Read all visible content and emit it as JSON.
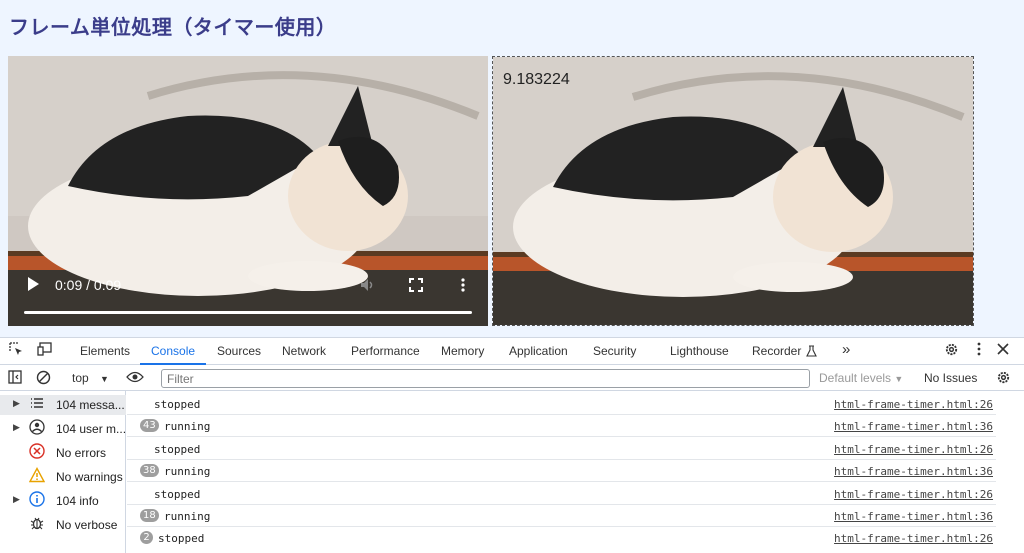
{
  "page": {
    "title": "フレーム単位処理（タイマー使用）"
  },
  "video": {
    "time_display": "0:09 / 0:09",
    "progress": 1.0
  },
  "canvas": {
    "frame_text": "9.183224"
  },
  "devtools": {
    "tabs": [
      "Elements",
      "Console",
      "Sources",
      "Network",
      "Performance",
      "Memory",
      "Application",
      "Security",
      "Lighthouse",
      "Recorder",
      "»"
    ],
    "active_tab": "Console",
    "toolbar": {
      "context": "top",
      "filter_placeholder": "Filter",
      "levels": "Default levels",
      "issues": "No Issues"
    },
    "sidebar": [
      {
        "label": "104 messa...",
        "icon": "list-icon",
        "expandable": true,
        "selected": true
      },
      {
        "label": "104 user m...",
        "icon": "user-icon",
        "expandable": true,
        "selected": false
      },
      {
        "label": "No errors",
        "icon": "error-icon",
        "expandable": false,
        "selected": false
      },
      {
        "label": "No warnings",
        "icon": "warning-icon",
        "expandable": false,
        "selected": false
      },
      {
        "label": "104 info",
        "icon": "info-icon",
        "expandable": true,
        "selected": false
      },
      {
        "label": "No verbose",
        "icon": "bug-icon",
        "expandable": false,
        "selected": false
      }
    ],
    "logs": [
      {
        "count": "",
        "message": "stopped",
        "source": "html-frame-timer.html:26"
      },
      {
        "count": "43",
        "message": "running",
        "source": "html-frame-timer.html:36"
      },
      {
        "count": "",
        "message": "stopped",
        "source": "html-frame-timer.html:26"
      },
      {
        "count": "38",
        "message": "running",
        "source": "html-frame-timer.html:36"
      },
      {
        "count": "",
        "message": "stopped",
        "source": "html-frame-timer.html:26"
      },
      {
        "count": "18",
        "message": "running",
        "source": "html-frame-timer.html:36"
      },
      {
        "count": "2",
        "message": "stopped",
        "source": "html-frame-timer.html:26"
      }
    ]
  }
}
